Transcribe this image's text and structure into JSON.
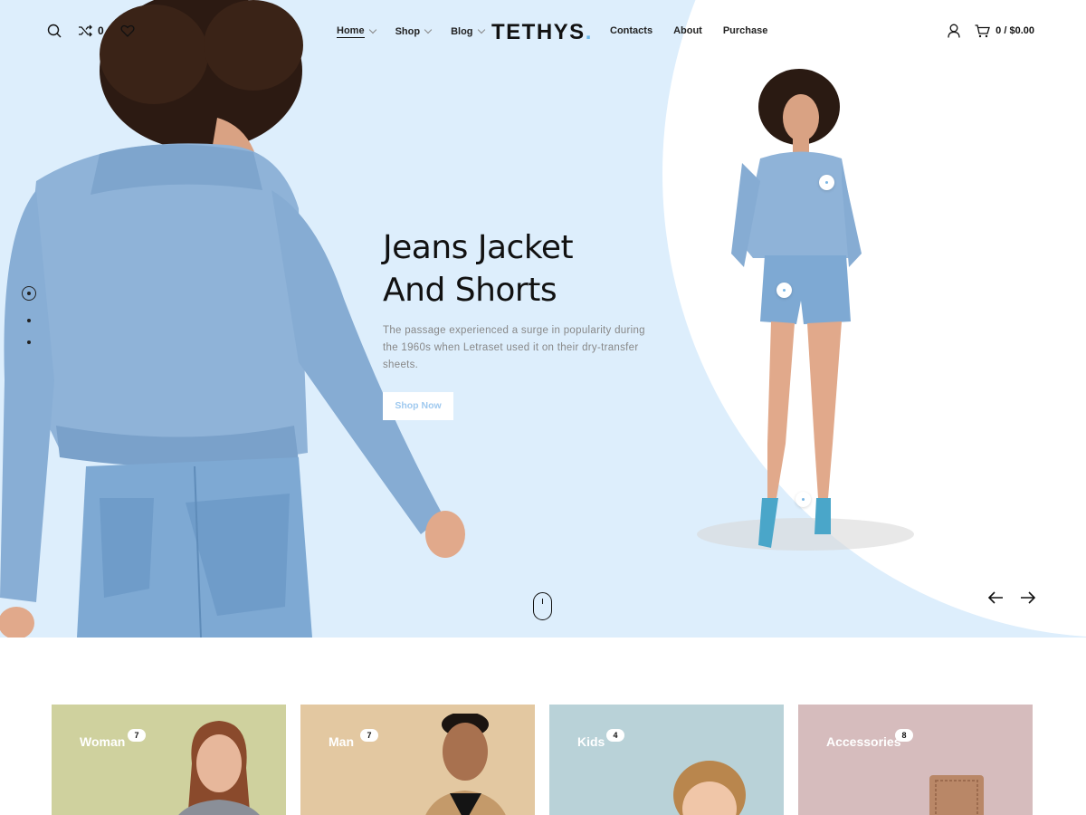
{
  "brand": {
    "logo": "TETHYS",
    "logo_dot": ".",
    "accent": "#6ab6e8",
    "hero_bg": "#ddeefc"
  },
  "header": {
    "compare_count": "0",
    "menu_left": [
      {
        "label": "Home",
        "active": true,
        "has_dropdown": true
      },
      {
        "label": "Shop",
        "has_dropdown": true
      },
      {
        "label": "Blog",
        "has_dropdown": true
      }
    ],
    "menu_right": [
      {
        "label": "Contacts"
      },
      {
        "label": "About"
      },
      {
        "label": "Purchase"
      }
    ],
    "cart_total": "0 / $0.00",
    "icons": {
      "search": "search-icon",
      "compare": "shuffle-icon",
      "wishlist": "heart-icon",
      "account": "user-icon",
      "cart": "cart-icon"
    }
  },
  "hero": {
    "title_line1": "Jeans Jacket",
    "title_line2": "And Shorts",
    "description": "The passage experienced a surge in popularity during the 1960s when Letraset used it on their dry-transfer sheets.",
    "cta": "Shop Now",
    "slide_count": 3,
    "active_slide": 1
  },
  "categories": [
    {
      "label": "Woman",
      "count": "7",
      "bg": "#cfd19e"
    },
    {
      "label": "Man",
      "count": "7",
      "bg": "#e3c8a1"
    },
    {
      "label": "Kids",
      "count": "4",
      "bg": "#b9d2d8"
    },
    {
      "label": "Accessories",
      "count": "8",
      "bg": "#d6bcbd"
    }
  ]
}
